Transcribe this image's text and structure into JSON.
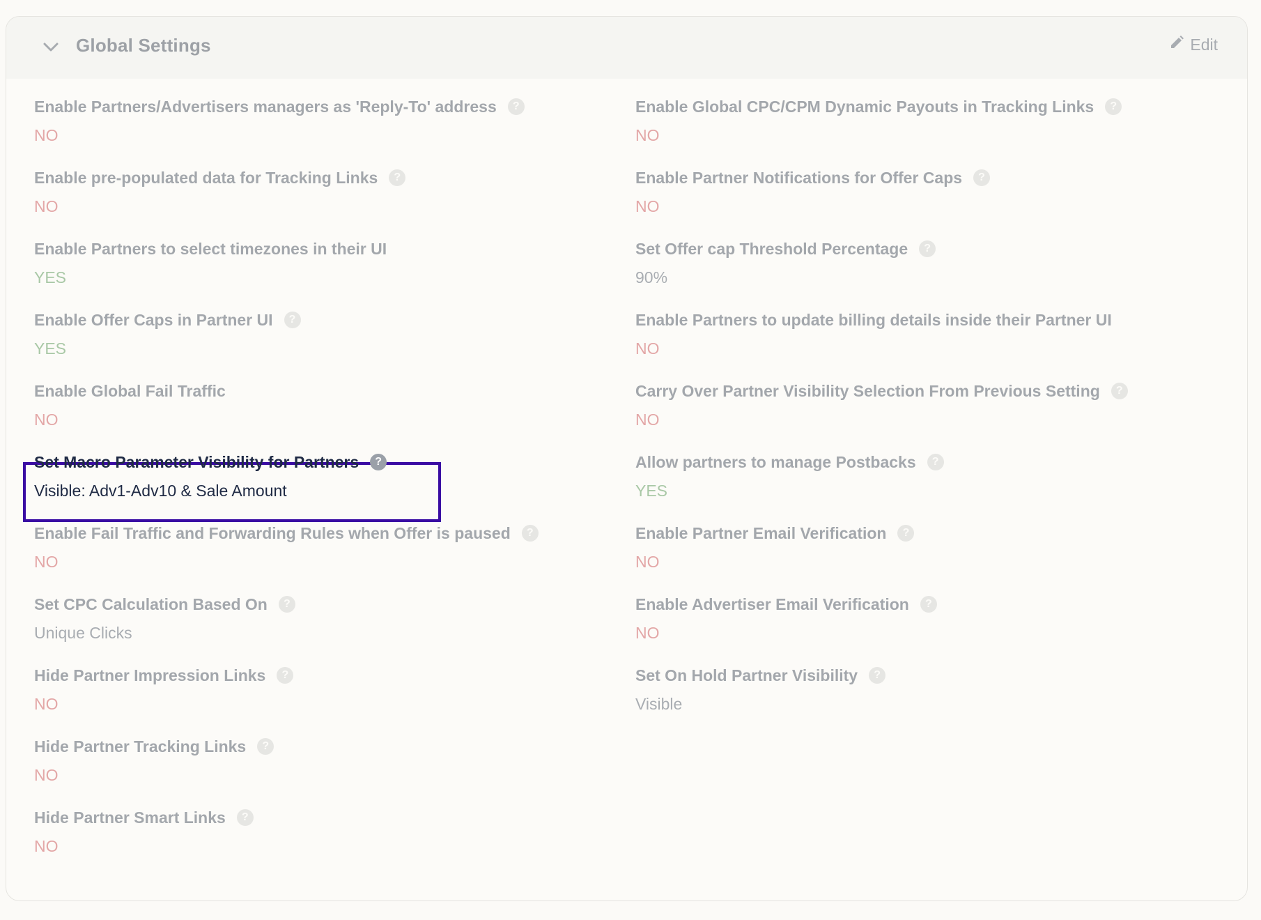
{
  "header": {
    "title": "Global Settings",
    "edit_label": "Edit",
    "chevron_icon": "chevron-down-icon",
    "edit_icon": "pencil-icon"
  },
  "left": [
    {
      "label": "Enable Partners/Advertisers managers as 'Reply-To' address",
      "help": true,
      "value": "NO",
      "kind": "no"
    },
    {
      "label": "Enable pre-populated data for Tracking Links",
      "help": true,
      "value": "NO",
      "kind": "no"
    },
    {
      "label": "Enable Partners to select timezones in their UI",
      "help": false,
      "value": "YES",
      "kind": "yes"
    },
    {
      "label": "Enable Offer Caps in Partner UI",
      "help": true,
      "value": "YES",
      "kind": "yes"
    },
    {
      "label": "Enable Global Fail Traffic",
      "help": false,
      "value": "NO",
      "kind": "no"
    },
    {
      "label": "Set Macro Parameter Visibility for Partners",
      "help": true,
      "value": "Visible: Adv1-Adv10 & Sale Amount",
      "kind": "active"
    },
    {
      "label": "Enable Fail Traffic and Forwarding Rules when Offer is paused",
      "help": true,
      "value": "NO",
      "kind": "no"
    },
    {
      "label": "Set CPC Calculation Based On",
      "help": true,
      "value": "Unique Clicks",
      "kind": "plain"
    },
    {
      "label": "Hide Partner Impression Links",
      "help": true,
      "value": "NO",
      "kind": "no"
    },
    {
      "label": "Hide Partner Tracking Links",
      "help": true,
      "value": "NO",
      "kind": "no"
    },
    {
      "label": "Hide Partner Smart Links",
      "help": true,
      "value": "NO",
      "kind": "no"
    }
  ],
  "right": [
    {
      "label": "Enable Global CPC/CPM Dynamic Payouts in Tracking Links",
      "help": true,
      "value": "NO",
      "kind": "no"
    },
    {
      "label": "Enable Partner Notifications for Offer Caps",
      "help": true,
      "value": "NO",
      "kind": "no"
    },
    {
      "label": "Set Offer cap Threshold Percentage",
      "help": true,
      "value": "90%",
      "kind": "plain"
    },
    {
      "label": "Enable Partners to update billing details inside their Partner UI",
      "help": false,
      "value": "NO",
      "kind": "no"
    },
    {
      "label": "Carry Over Partner Visibility Selection From Previous Setting",
      "help": true,
      "value": "NO",
      "kind": "no"
    },
    {
      "label": "Allow partners to manage Postbacks",
      "help": true,
      "value": "YES",
      "kind": "yes"
    },
    {
      "label": "Enable Partner Email Verification",
      "help": true,
      "value": "NO",
      "kind": "no"
    },
    {
      "label": "Enable Advertiser Email Verification",
      "help": true,
      "value": "NO",
      "kind": "no"
    },
    {
      "label": "Set On Hold Partner Visibility",
      "help": true,
      "value": "Visible",
      "kind": "plain"
    }
  ],
  "help_icon_glyph": "?",
  "colors": {
    "highlight_border": "#3a0ca3",
    "no": "#e3a7a7",
    "yes": "#a9c8a6",
    "active_text": "#1f2a44"
  }
}
